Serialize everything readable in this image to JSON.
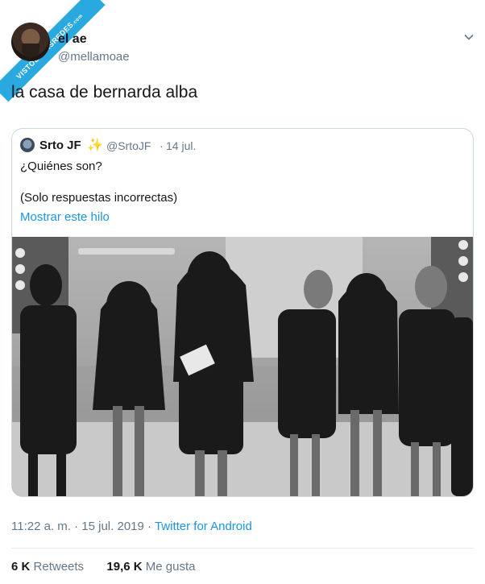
{
  "watermark": {
    "text": "VISTOENLASREDES",
    "suffix": ".com"
  },
  "author": {
    "name": "el ae",
    "handle": "@mellamoae"
  },
  "tweet_text": "la casa de bernarda alba",
  "quoted": {
    "name": "Srto JF",
    "emoji": "✨",
    "handle": "@SrtoJF",
    "separator": "·",
    "date": "14 jul.",
    "line1": "¿Quiénes son?",
    "line2": "(Solo respuestas incorrectas)",
    "show_thread": "Mostrar este hilo"
  },
  "meta": {
    "time": "11:22 a. m.",
    "separator": "·",
    "date": "15 jul. 2019",
    "source": "Twitter for Android"
  },
  "stats": {
    "retweets_count": "6 K",
    "retweets_label": "Retweets",
    "likes_count": "19,6 K",
    "likes_label": "Me gusta"
  },
  "colors": {
    "link": "#1b95e0",
    "secondary": "#657786",
    "ribbon": "#2aa9e0"
  }
}
